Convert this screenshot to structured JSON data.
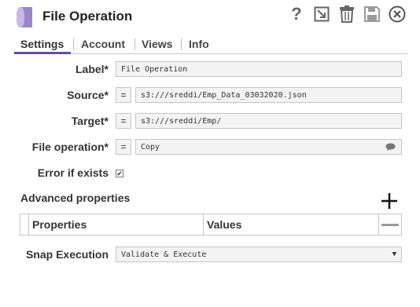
{
  "header": {
    "title": "File Operation",
    "icons": [
      "help-icon",
      "export-icon",
      "delete-icon",
      "save-icon",
      "close-icon"
    ],
    "help_glyph": "?"
  },
  "tabs": [
    {
      "label": "Settings",
      "active": true
    },
    {
      "label": "Account"
    },
    {
      "label": "Views"
    },
    {
      "label": "Info"
    }
  ],
  "fields": {
    "label": {
      "name": "Label*",
      "value": "File Operation"
    },
    "source": {
      "name": "Source*",
      "value": "s3:///sreddi/Emp_Data_03032020.json",
      "eq": "="
    },
    "target": {
      "name": "Target*",
      "value": "s3:///sreddi/Emp/",
      "eq": "="
    },
    "file_operation": {
      "name": "File operation*",
      "value": "Copy",
      "eq": "="
    },
    "error_if_exists": {
      "name": "Error if exists",
      "checked": true,
      "check_glyph": "✔"
    }
  },
  "advanced": {
    "title": "Advanced properties",
    "columns": [
      "Properties",
      "Values"
    ]
  },
  "snap_execution": {
    "name": "Snap Execution",
    "value": "Validate & Execute",
    "caret": "▼"
  },
  "colors": {
    "accent": "#6b4a9a",
    "field_bg": "#f3f3f3",
    "border": "#c6c6c6"
  }
}
